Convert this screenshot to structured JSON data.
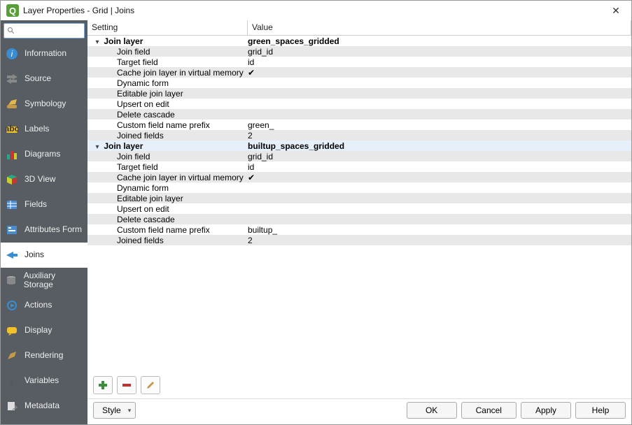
{
  "window": {
    "title": "Layer Properties - Grid | Joins"
  },
  "search": {
    "placeholder": ""
  },
  "sidebar": {
    "items": [
      {
        "label": "Information"
      },
      {
        "label": "Source"
      },
      {
        "label": "Symbology"
      },
      {
        "label": "Labels"
      },
      {
        "label": "Diagrams"
      },
      {
        "label": "3D View"
      },
      {
        "label": "Fields"
      },
      {
        "label": "Attributes Form"
      },
      {
        "label": "Joins"
      },
      {
        "label": "Auxiliary Storage"
      },
      {
        "label": "Actions"
      },
      {
        "label": "Display"
      },
      {
        "label": "Rendering"
      },
      {
        "label": "Variables"
      },
      {
        "label": "Metadata"
      }
    ]
  },
  "headers": {
    "setting": "Setting",
    "value": "Value"
  },
  "joins": [
    {
      "title": "Join layer",
      "layer": "green_spaces_gridded",
      "rows": [
        {
          "k": "Join field",
          "v": "grid_id"
        },
        {
          "k": "Target field",
          "v": "id"
        },
        {
          "k": "Cache join layer in virtual memory",
          "v": "✔"
        },
        {
          "k": "Dynamic form",
          "v": ""
        },
        {
          "k": "Editable join layer",
          "v": ""
        },
        {
          "k": "Upsert on edit",
          "v": ""
        },
        {
          "k": "Delete cascade",
          "v": ""
        },
        {
          "k": "Custom field name prefix",
          "v": "green_"
        },
        {
          "k": "Joined fields",
          "v": "2"
        }
      ]
    },
    {
      "title": "Join layer",
      "layer": "builtup_spaces_gridded",
      "rows": [
        {
          "k": "Join field",
          "v": "grid_id"
        },
        {
          "k": "Target field",
          "v": "id"
        },
        {
          "k": "Cache join layer in virtual memory",
          "v": "✔"
        },
        {
          "k": "Dynamic form",
          "v": ""
        },
        {
          "k": "Editable join layer",
          "v": ""
        },
        {
          "k": "Upsert on edit",
          "v": ""
        },
        {
          "k": "Delete cascade",
          "v": ""
        },
        {
          "k": "Custom field name prefix",
          "v": "builtup_"
        },
        {
          "k": "Joined fields",
          "v": "2"
        }
      ]
    }
  ],
  "footer": {
    "style": "Style",
    "ok": "OK",
    "cancel": "Cancel",
    "apply": "Apply",
    "help": "Help"
  }
}
